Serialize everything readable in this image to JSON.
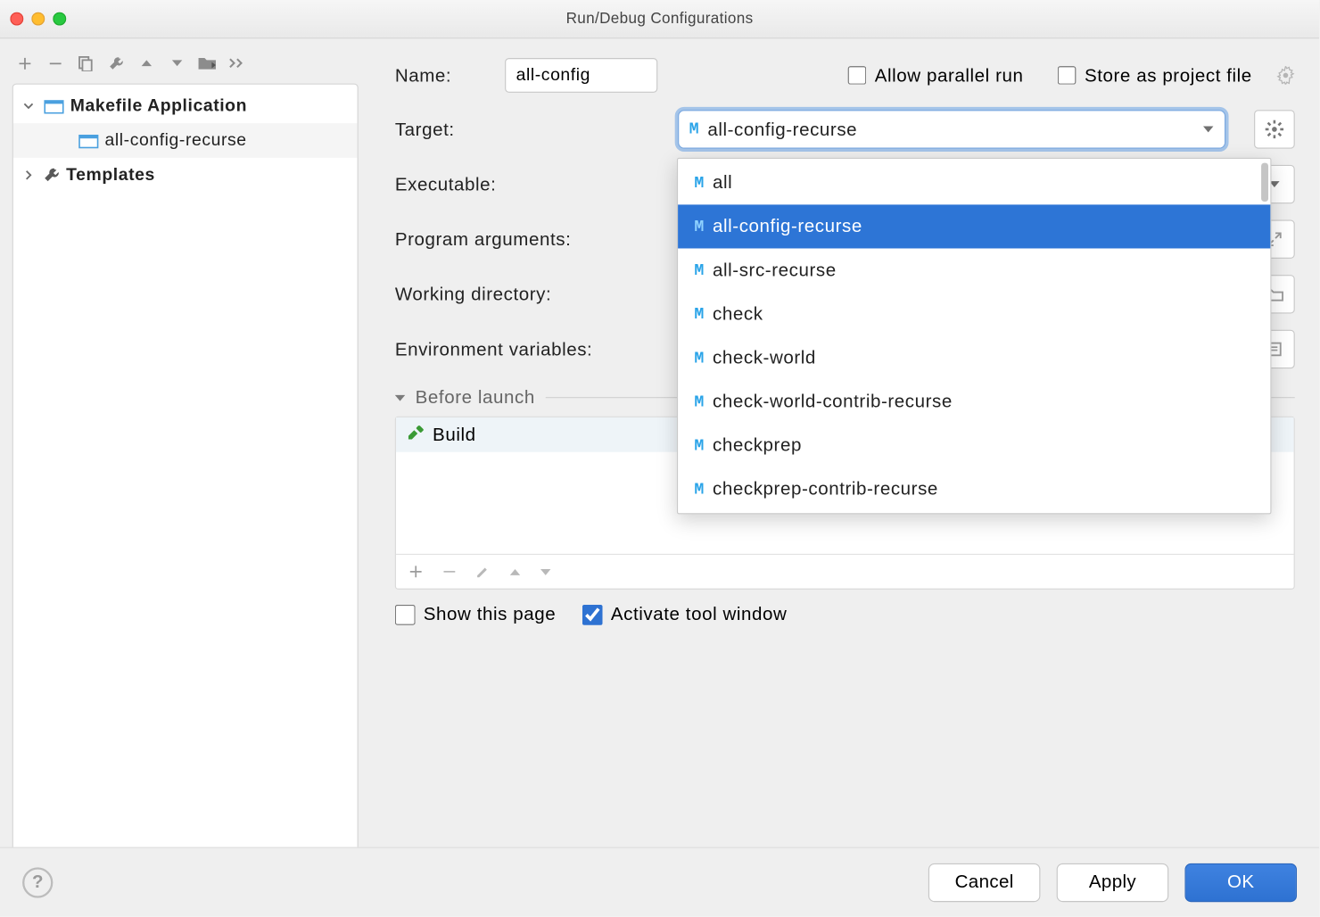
{
  "window": {
    "title": "Run/Debug Configurations"
  },
  "sidebar": {
    "nodes": [
      {
        "label": "Makefile Application",
        "expanded": true
      },
      {
        "label": "all-config-recurse"
      },
      {
        "label": "Templates",
        "expanded": false
      }
    ]
  },
  "form": {
    "name_label": "Name:",
    "name_value": "all-config",
    "allow_parallel_label": "Allow parallel run",
    "store_as_project_label": "Store as project file",
    "target_label": "Target:",
    "target_value": "all-config-recurse",
    "target_options": [
      "all",
      "all-config-recurse",
      "all-src-recurse",
      "check",
      "check-world",
      "check-world-contrib-recurse",
      "checkprep",
      "checkprep-contrib-recurse"
    ],
    "target_selected_index": 1,
    "executable_label": "Executable:",
    "program_args_label": "Program arguments:",
    "working_dir_label": "Working directory:",
    "env_vars_label": "Environment variables:"
  },
  "before_launch": {
    "header": "Before launch",
    "items": [
      {
        "label": "Build"
      }
    ]
  },
  "footer": {
    "show_this_page": "Show this page",
    "activate_tool_window": "Activate tool window"
  },
  "buttons": {
    "cancel": "Cancel",
    "apply": "Apply",
    "ok": "OK"
  }
}
